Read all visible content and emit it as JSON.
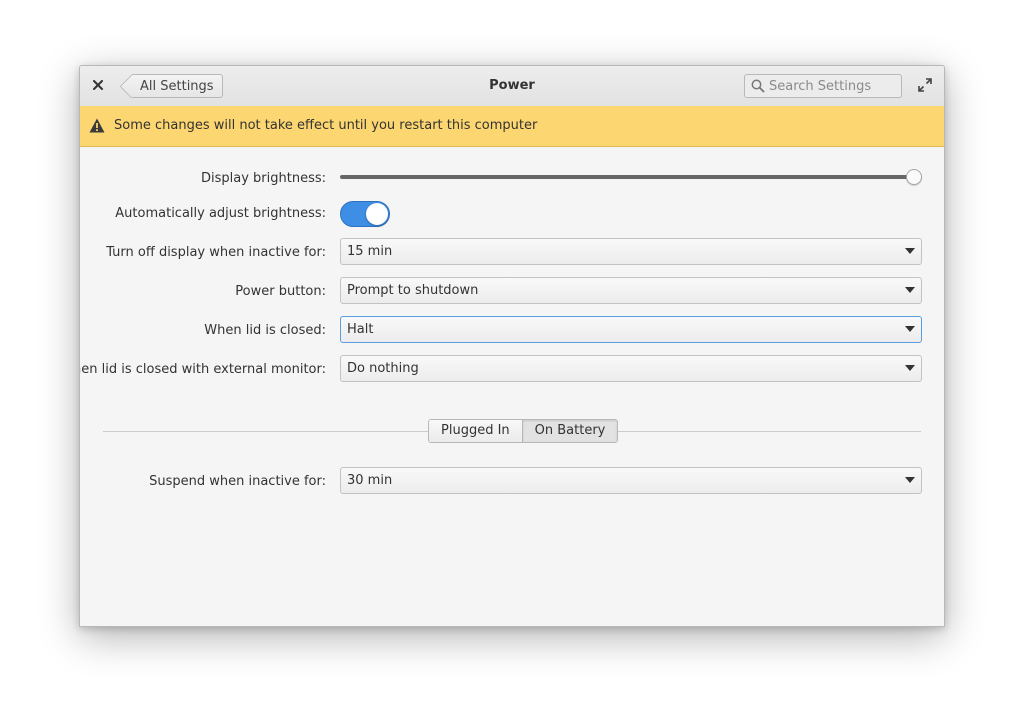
{
  "window": {
    "title": "Power",
    "back_label": "All Settings",
    "search_placeholder": "Search Settings"
  },
  "infobar": {
    "message": "Some changes will not take effect until you restart this computer",
    "color": "#fcd670"
  },
  "settings": {
    "display_brightness": {
      "label": "Display brightness:",
      "value_percent": 100
    },
    "auto_brightness": {
      "label": "Automatically adjust brightness:",
      "enabled": true
    },
    "display_off": {
      "label": "Turn off display when inactive for:",
      "value": "15 min"
    },
    "power_button": {
      "label": "Power button:",
      "value": "Prompt to shutdown"
    },
    "lid_closed": {
      "label": "When lid is closed:",
      "value": "Halt"
    },
    "lid_closed_external": {
      "label": "When lid is closed with external monitor:",
      "value": "Do nothing"
    }
  },
  "tabs": [
    {
      "label": "Plugged In",
      "active": false
    },
    {
      "label": "On Battery",
      "active": true
    }
  ],
  "battery": {
    "suspend": {
      "label": "Suspend when inactive for:",
      "value": "30 min"
    }
  },
  "colors": {
    "accent": "#3d8ee4",
    "focus_border": "#5b9ee0",
    "window_bg": "#f5f5f5"
  },
  "icons": {
    "close": "close-icon",
    "back": "chevron-left-icon",
    "search": "search-icon",
    "maximize": "maximize-icon",
    "warning": "warning-icon",
    "dropdown": "dropdown-arrow-icon"
  }
}
